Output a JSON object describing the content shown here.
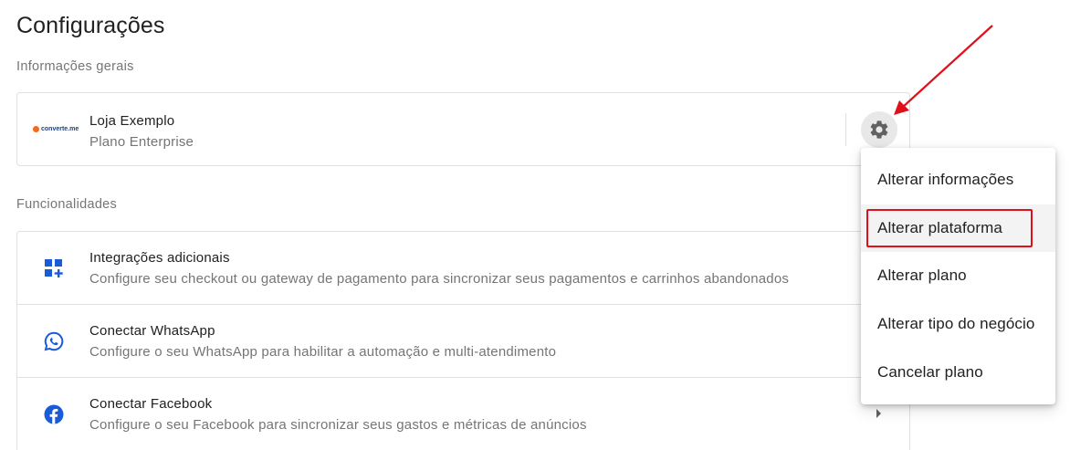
{
  "page": {
    "title": "Configurações"
  },
  "general": {
    "section_label": "Informações gerais",
    "store": {
      "logo_text": "converte.me",
      "name": "Loja Exemplo",
      "plan": "Plano Enterprise"
    }
  },
  "features": {
    "section_label": "Funcionalidades",
    "items": [
      {
        "icon": "add-grid-icon",
        "title": "Integrações adicionais",
        "subtitle": "Configure seu checkout ou gateway de pagamento para sincronizar seus pagamentos e carrinhos abandonados"
      },
      {
        "icon": "whatsapp-icon",
        "title": "Conectar WhatsApp",
        "subtitle": "Configure o seu WhatsApp para habilitar a automação e multi-atendimento"
      },
      {
        "icon": "facebook-icon",
        "title": "Conectar Facebook",
        "subtitle": "Configure o seu Facebook para sincronizar seus gastos e métricas de anúncios"
      }
    ]
  },
  "settings_menu": {
    "items": [
      {
        "label": "Alterar informações"
      },
      {
        "label": "Alterar plataforma"
      },
      {
        "label": "Alterar plano"
      },
      {
        "label": "Alterar tipo do negócio"
      },
      {
        "label": "Cancelar plano"
      }
    ],
    "highlighted_index": 1
  },
  "colors": {
    "accent_blue": "#1a5bd8",
    "annotation_red": "#e0101a",
    "logo_orange": "#f26a21"
  }
}
